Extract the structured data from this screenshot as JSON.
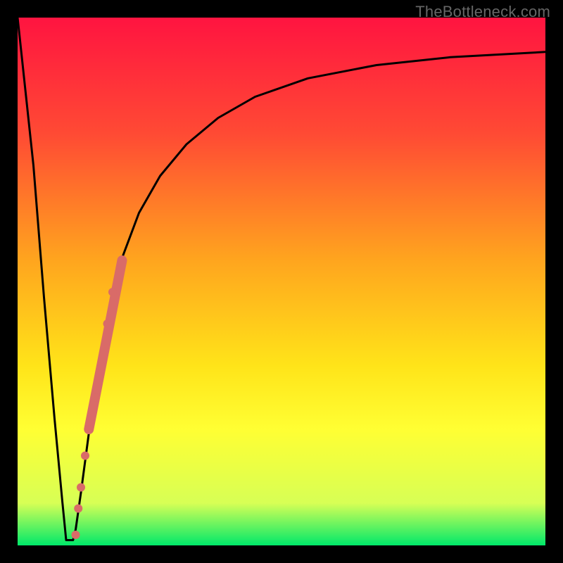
{
  "watermark": "TheBottleneck.com",
  "chart_data": {
    "type": "line",
    "title": "",
    "xlabel": "",
    "ylabel": "",
    "xlim": [
      0,
      100
    ],
    "ylim": [
      0,
      100
    ],
    "gradient_stops": [
      {
        "pct": 0,
        "color": "#ff1440"
      },
      {
        "pct": 22,
        "color": "#ff4a34"
      },
      {
        "pct": 46,
        "color": "#ffa51e"
      },
      {
        "pct": 66,
        "color": "#ffe419"
      },
      {
        "pct": 78,
        "color": "#ffff33"
      },
      {
        "pct": 92,
        "color": "#d7ff55"
      },
      {
        "pct": 100,
        "color": "#00e86a"
      }
    ],
    "series": [
      {
        "name": "curve",
        "x": [
          0,
          3,
          5,
          7,
          8.5,
          9.2,
          10,
          10.5,
          11,
          12,
          14,
          16,
          18,
          20,
          23,
          27,
          32,
          38,
          45,
          55,
          68,
          82,
          100
        ],
        "y": [
          100,
          72,
          47,
          24,
          8,
          1,
          1,
          1,
          3,
          10,
          25,
          38,
          48,
          55,
          63,
          70,
          76,
          81,
          85,
          88.5,
          91,
          92.5,
          93.5
        ]
      }
    ],
    "markers": [
      {
        "x": 13.5,
        "y": 22,
        "r": 6
      },
      {
        "x": 18.0,
        "y": 48,
        "r": 6
      },
      {
        "x": 17.0,
        "y": 42,
        "r": 6
      },
      {
        "x": 15.8,
        "y": 34,
        "r": 6
      },
      {
        "x": 14.8,
        "y": 28,
        "r": 6
      },
      {
        "x": 12.8,
        "y": 17,
        "r": 6
      },
      {
        "x": 12.0,
        "y": 11,
        "r": 6
      },
      {
        "x": 11.5,
        "y": 7,
        "r": 6
      },
      {
        "x": 11.0,
        "y": 2,
        "r": 6
      }
    ],
    "thick_segment": {
      "x0": 13.5,
      "y0": 22,
      "x1": 19.8,
      "y1": 54
    }
  }
}
